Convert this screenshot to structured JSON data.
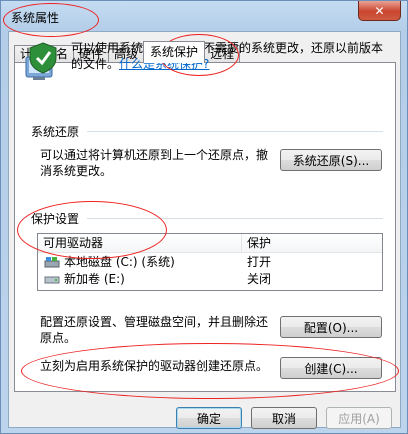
{
  "window": {
    "title": "系统属性",
    "close_label": "✕"
  },
  "tabs": [
    {
      "label": "计算机名",
      "active": false
    },
    {
      "label": "硬件",
      "active": false
    },
    {
      "label": "高级",
      "active": false
    },
    {
      "label": "系统保护",
      "active": true
    },
    {
      "label": "远程",
      "active": false
    }
  ],
  "info": {
    "text": "可以使用系统保护来撤消不需要的系统更改，还原以前版本的文件。",
    "link": "什么是系统保护?"
  },
  "restore": {
    "section_title": "系统还原",
    "description": "可以通过将计算机还原到上一个还原点，撤消系统更改。",
    "button_label": "系统还原(S)..."
  },
  "protection": {
    "section_title": "保护设置",
    "columns": [
      "可用驱动器",
      "保护"
    ],
    "drives": [
      {
        "name": "本地磁盘 (C:) (系统)",
        "status": "打开",
        "icon": "system-drive-icon"
      },
      {
        "name": "新加卷 (E:)",
        "status": "关闭",
        "icon": "drive-icon"
      }
    ],
    "configure_text": "配置还原设置、管理磁盘空间，并且删除还原点。",
    "configure_button": "配置(O)...",
    "create_text": "立刻为启用系统保护的驱动器创建还原点。",
    "create_button": "创建(C)..."
  },
  "footer": {
    "ok": "确定",
    "cancel": "取消",
    "apply": "应用(A)"
  },
  "colors": {
    "link": "#0066cc",
    "annotation": "#e22222"
  }
}
